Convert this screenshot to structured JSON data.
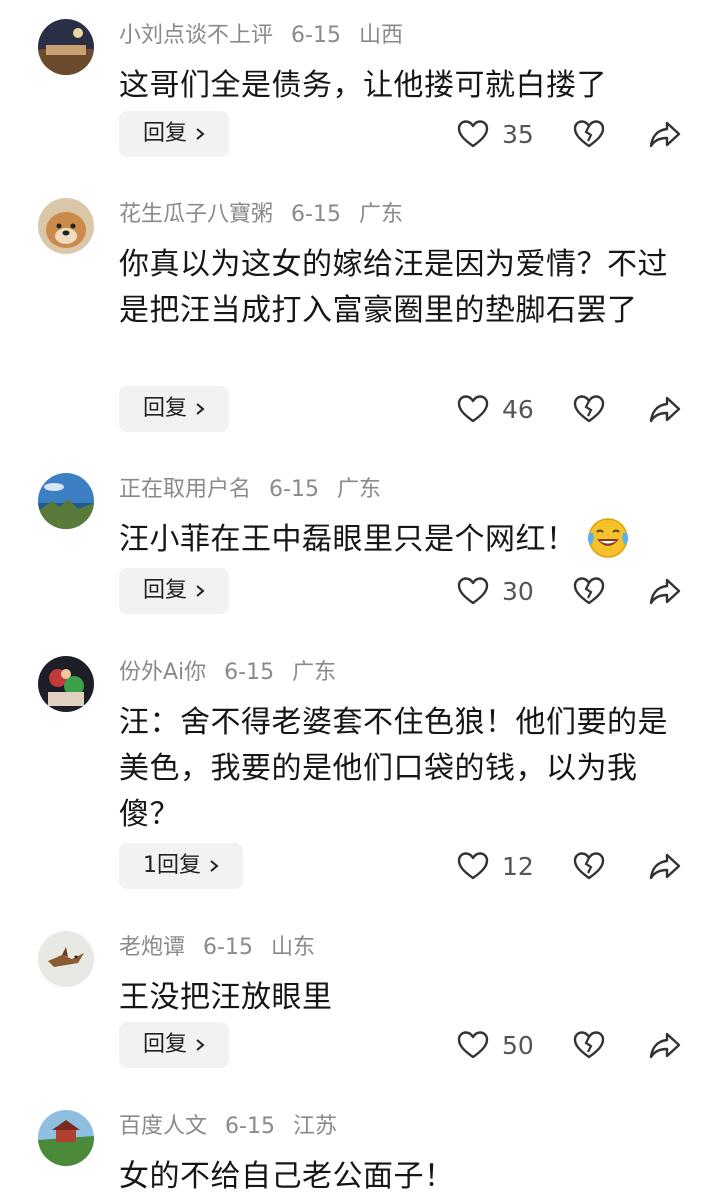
{
  "comments": [
    {
      "user": "小刘点谈不上评",
      "date": "6-15",
      "region": "山西",
      "text": "这哥们全是债务，让他搂可就白搂了",
      "reply_label": "回复",
      "likes": "35"
    },
    {
      "user": "花生瓜子八寶粥",
      "date": "6-15",
      "region": "广东",
      "text": "你真以为这女的嫁给汪是因为爱情？不过是把汪当成打入富豪圈里的垫脚石罢了",
      "reply_label": "回复",
      "likes": "46"
    },
    {
      "user": "正在取用户名",
      "date": "6-15",
      "region": "广东",
      "text": "汪小菲在王中磊眼里只是个网红！",
      "emoji": "laughing-crying-emoji",
      "reply_label": "回复",
      "likes": "30"
    },
    {
      "user": "份外Ai你",
      "date": "6-15",
      "region": "广东",
      "text": "汪：舍不得老婆套不住色狼！他们要的是美色，我要的是他们口袋的钱，以为我傻？",
      "reply_label": "1回复",
      "likes": "12"
    },
    {
      "user": "老炮谭",
      "date": "6-15",
      "region": "山东",
      "text": "王没把汪放眼里",
      "reply_label": "回复",
      "likes": "50"
    },
    {
      "user": "百度人文",
      "date": "6-15",
      "region": "江苏",
      "text": "女的不给自己老公面子！"
    }
  ],
  "icons": {
    "like": "heart-outline-icon",
    "dislike": "broken-heart-icon",
    "share": "share-arrow-icon",
    "reply_chevron": "chevron-right-icon"
  },
  "colors": {
    "meta_text": "#8a8a8a",
    "body_text": "#161616",
    "reply_bg": "#f2f2f2",
    "icon_stroke": "#333333"
  }
}
